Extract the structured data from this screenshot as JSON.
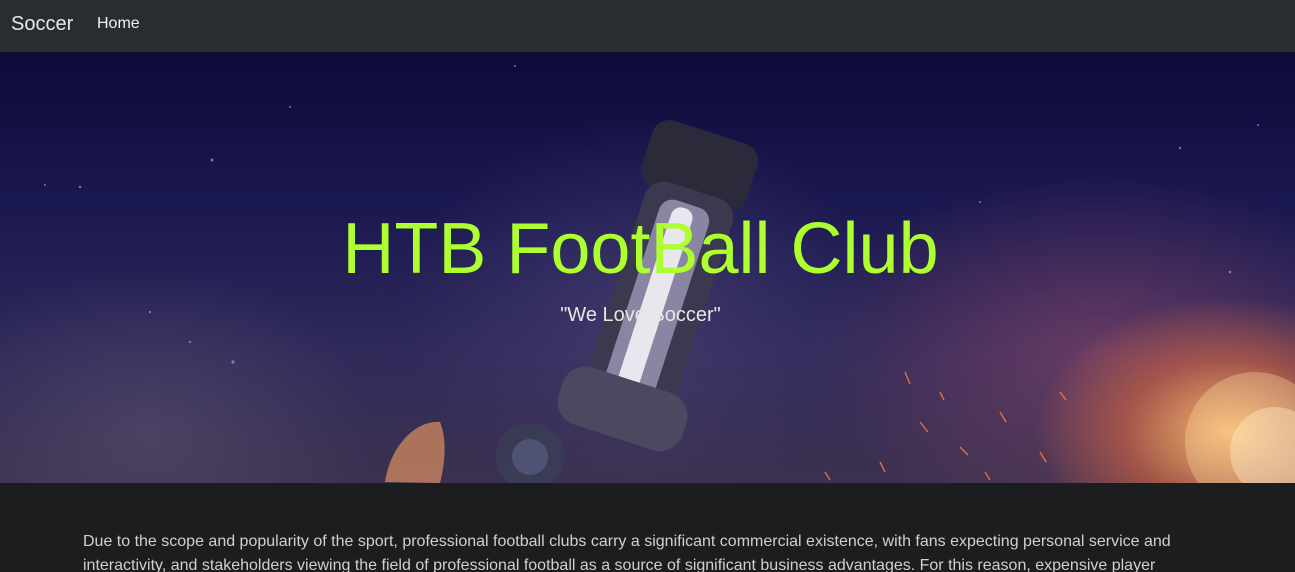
{
  "navbar": {
    "brand": "Soccer",
    "home_label": "Home"
  },
  "hero": {
    "title": "HTB FootBall Club",
    "tagline": "\"We Love Soccer\"",
    "title_color": "#adff2f"
  },
  "content": {
    "paragraph": "Due to the scope and popularity of the sport, professional football clubs carry a significant commercial existence, with fans expecting personal service and interactivity, and stakeholders viewing the field of professional football as a source of significant business advantages. For this reason, expensive player"
  }
}
